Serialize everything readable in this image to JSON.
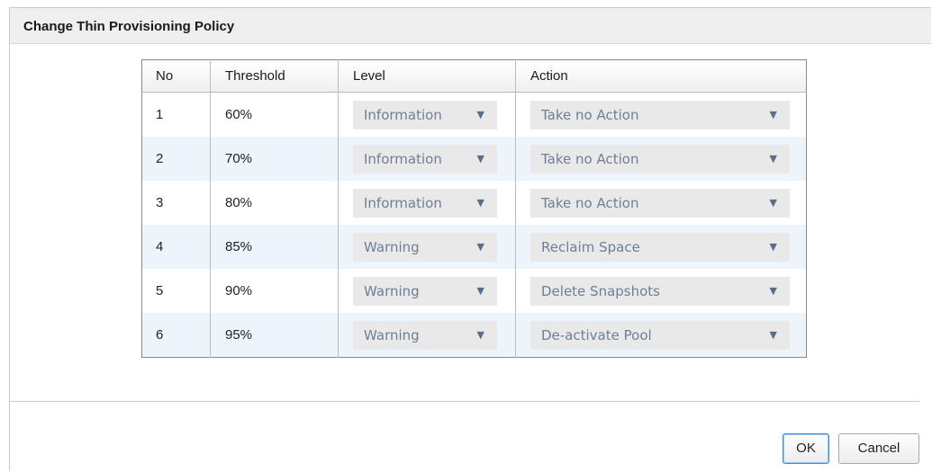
{
  "dialog": {
    "title": "Change Thin Provisioning Policy"
  },
  "table": {
    "headers": {
      "no": "No",
      "threshold": "Threshold",
      "level": "Level",
      "action": "Action"
    },
    "rows": [
      {
        "no": "1",
        "threshold": "60%",
        "level": "Information",
        "action": "Take no Action"
      },
      {
        "no": "2",
        "threshold": "70%",
        "level": "Information",
        "action": "Take no Action"
      },
      {
        "no": "3",
        "threshold": "80%",
        "level": "Information",
        "action": "Take no Action"
      },
      {
        "no": "4",
        "threshold": "85%",
        "level": "Warning",
        "action": "Reclaim Space"
      },
      {
        "no": "5",
        "threshold": "90%",
        "level": "Warning",
        "action": "Delete Snapshots"
      },
      {
        "no": "6",
        "threshold": "95%",
        "level": "Warning",
        "action": "De-activate Pool"
      }
    ]
  },
  "buttons": {
    "ok": "OK",
    "cancel": "Cancel"
  },
  "icons": {
    "dropdown": "chevron-down-icon"
  },
  "colors": {
    "row_alt": "#eef4fc",
    "select_bg": "#e9e9e9",
    "select_text": "#6f7f95",
    "ok_focus": "#3d8ad6"
  }
}
